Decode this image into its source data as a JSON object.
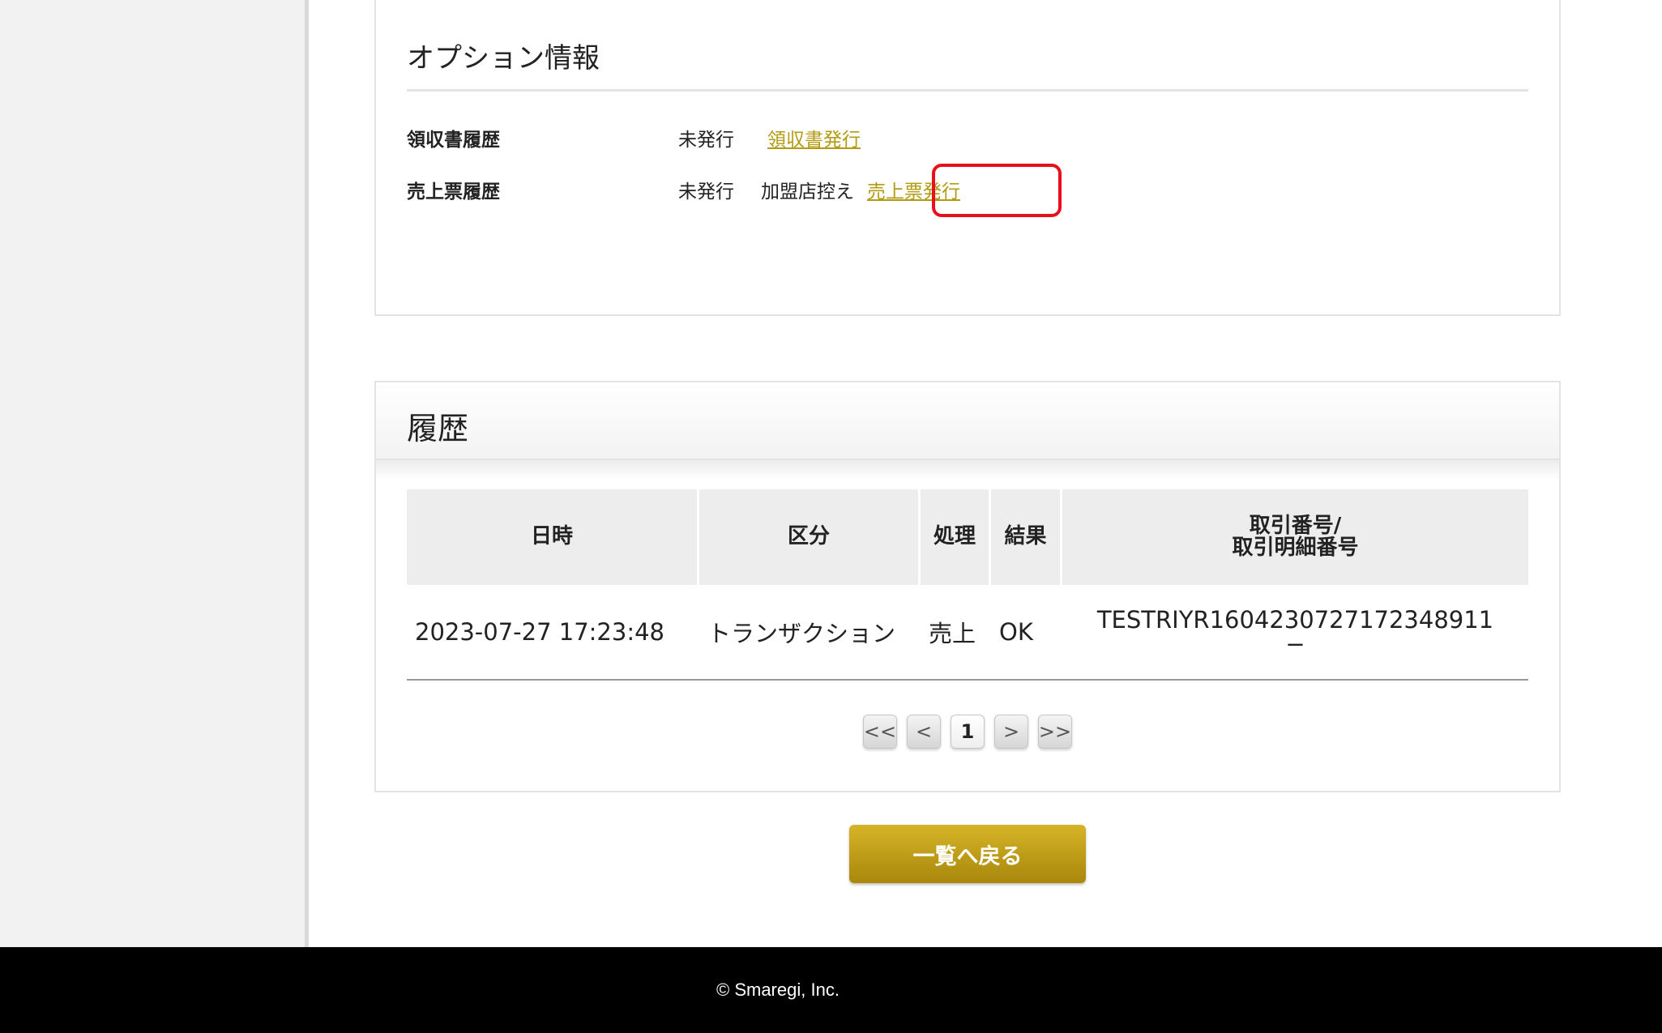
{
  "options": {
    "title": "オプション情報",
    "receipt": {
      "label": "領収書履歴",
      "status": "未発行",
      "link": "領収書発行"
    },
    "sales_slip": {
      "label": "売上票履歴",
      "status": "未発行",
      "copy": "加盟店控え",
      "link": "売上票発行"
    }
  },
  "history": {
    "title": "履歴",
    "columns": [
      "日時",
      "区分",
      "処理",
      "結果",
      "取引番号/\n取引明細番号"
    ],
    "rows": [
      {
        "datetime": "2023-07-27 17:23:48",
        "category": "トランザクション",
        "process": "売上",
        "result": "OK",
        "txn_no": "TESTRIYR1604230727172348911",
        "detail_no": "−"
      }
    ],
    "pager": {
      "first": "<<",
      "prev": "<",
      "current": "1",
      "next": ">",
      "last": ">>"
    }
  },
  "back_button": "一覧へ戻る",
  "footer": "© Smaregi, Inc.",
  "colors": {
    "link": "#b39b12",
    "highlight": "#e8101a",
    "button": "#b8970f",
    "footer_bg": "#000000"
  }
}
